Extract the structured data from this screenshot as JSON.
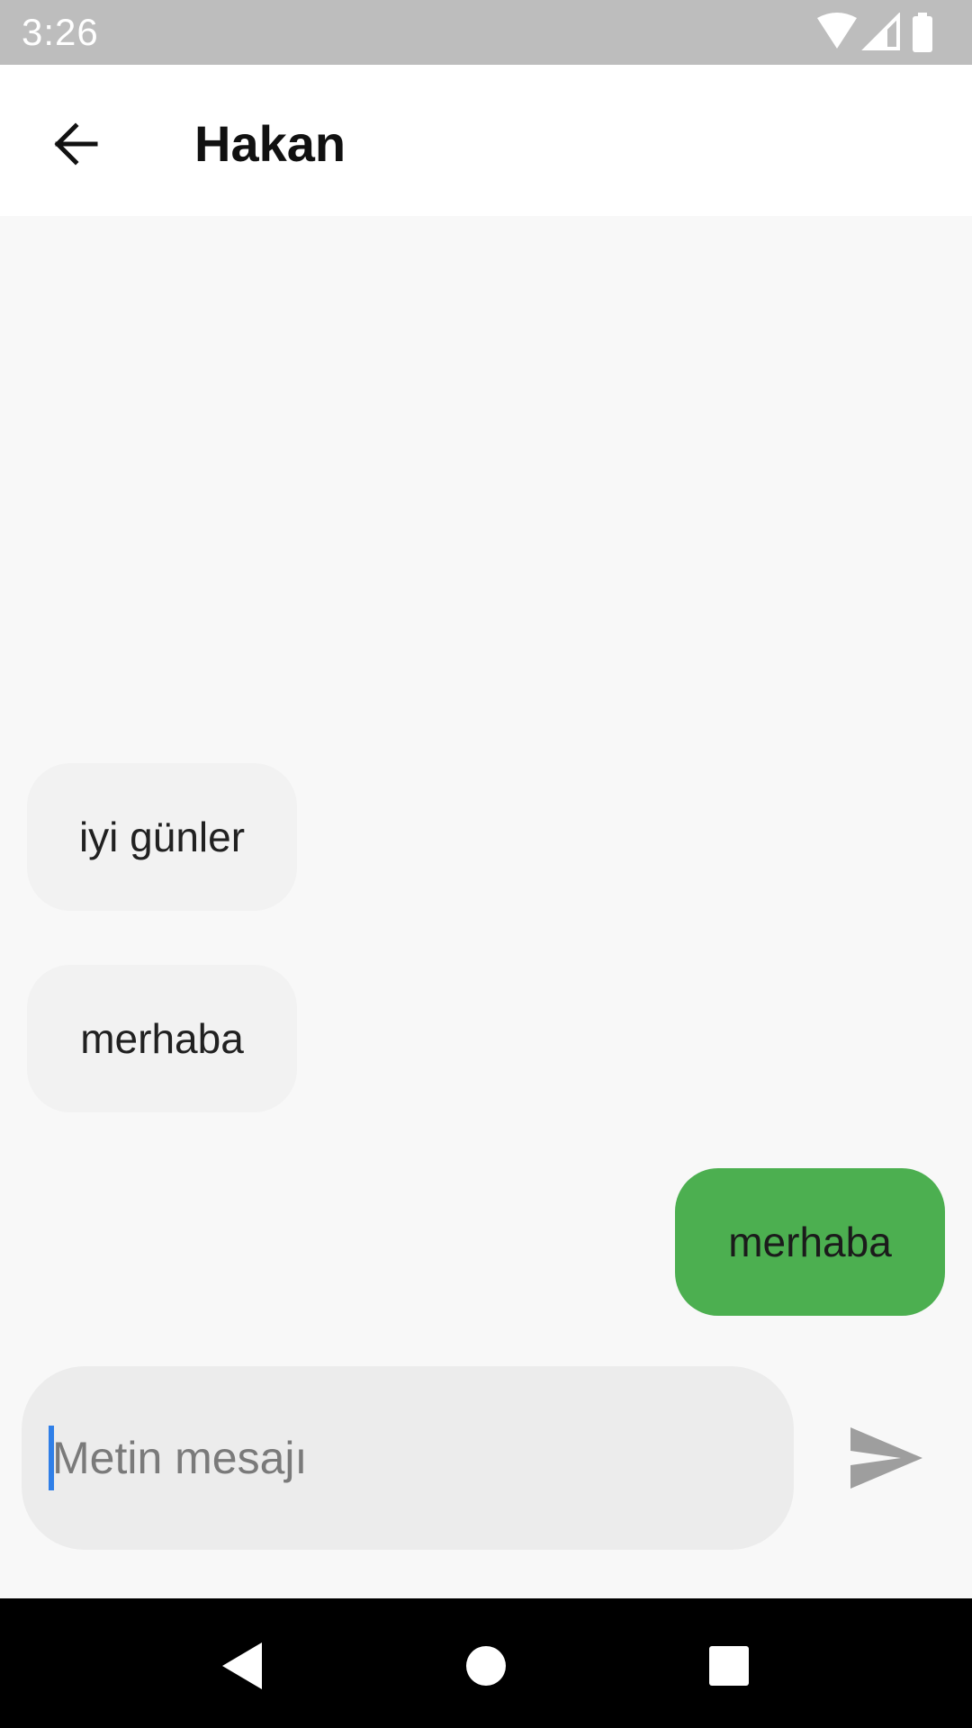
{
  "status_bar": {
    "time": "3:26",
    "icons": [
      "wifi-icon",
      "signal-icon",
      "battery-icon"
    ]
  },
  "app_bar": {
    "back_icon": "arrow-back-icon",
    "title": "Hakan"
  },
  "messages": [
    {
      "text": "iyi günler",
      "direction": "incoming"
    },
    {
      "text": "merhaba",
      "direction": "incoming"
    },
    {
      "text": "merhaba",
      "direction": "outgoing"
    }
  ],
  "composer": {
    "placeholder": "Metin mesajı",
    "value": "",
    "send_icon": "send-icon"
  },
  "navigation": {
    "icons": [
      "nav-back-icon",
      "nav-home-icon",
      "nav-recents-icon"
    ]
  },
  "colors": {
    "status_bar": "#bdbdbd",
    "outgoing_bubble": "#4caf50",
    "incoming_bubble": "#f2f2f2",
    "background": "#f8f8f8",
    "caret": "#2f7fe8"
  }
}
